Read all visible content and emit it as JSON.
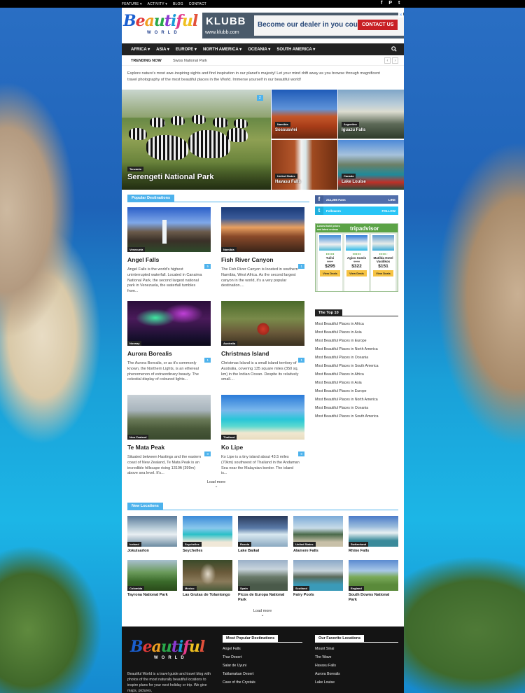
{
  "topbar": {
    "menu": [
      "FEATURE ▾",
      "ACTIVITY ▾",
      "BLOG",
      "CONTACT"
    ],
    "social": [
      "f",
      "P",
      "t"
    ]
  },
  "logo": {
    "word": "Beautiful",
    "sub": "WORLD"
  },
  "ad": {
    "brand": "KLUBB",
    "url": "www.klubb.com",
    "message": "Become our dealer in you country!",
    "cta": "CONTACT US",
    "close": "✕"
  },
  "nav": {
    "items": [
      "AFRICA ▾",
      "ASIA ▾",
      "EUROPE ▾",
      "NORTH AMERICA ▾",
      "OCEANIA ▾",
      "SOUTH AMERICA ▾"
    ]
  },
  "trending": {
    "label": "TRENDING NOW",
    "item": "Swiss National Park",
    "prev": "‹",
    "next": "›"
  },
  "intro": "Explore nature's most awe-inspiring sights and find inspiration in our planet's majesty! Let your mind drift away as you browse through magnificent travel photography of the most beautiful places in the World. Immerse yourself in our beautiful world!",
  "hero": {
    "big": {
      "category": "Tanzania",
      "title": "Serengeti National Park",
      "count": "2"
    },
    "small": [
      {
        "category": "Namibia",
        "title": "Sossusvlei"
      },
      {
        "category": "Argentina",
        "title": "Iguazu Falls"
      },
      {
        "category": "United States",
        "title": "Havasu Falls"
      },
      {
        "category": "Canada",
        "title": "Lake Louise"
      }
    ]
  },
  "popular": {
    "heading": "Popular Destinations",
    "load_more": "Load more",
    "cards": [
      {
        "category": "Venezuela",
        "title": "Angel Falls",
        "count": "5",
        "excerpt": "Angel Falls is the world's highest uninterrupted waterfall. Located in Canaima National Park, the second largest national park in Venezuela, the waterfall tumbles from..."
      },
      {
        "category": "Namibia",
        "title": "Fish River Canyon",
        "count": "1",
        "excerpt": "The Fish River Canyon is located in southern Namibia, West Africa. As the second largest canyon in the world, it's a very popular destination...."
      },
      {
        "category": "Norway",
        "title": "Aurora Borealis",
        "count": "1",
        "excerpt": "The Aurora Borealis, or as it's commonly known, the Northern Lights, is an ethereal phenomenon of extraordinary beauty. The celestial display of coloured lights..."
      },
      {
        "category": "Australia",
        "title": "Christmas Island",
        "count": "1",
        "excerpt": "Christmas Island is a small island territory of Australia, covering 135 square miles (350 sq. km) in the Indian Ocean. Despite its relatively small...."
      },
      {
        "category": "New Zealand",
        "title": "Te Mata Peak",
        "count": "0",
        "excerpt": "Situated between Hastings and the eastern coast of New Zealand, Te Mata Peak is an incredible hillscape rising 1310ft (399m) above sea level. It's..."
      },
      {
        "category": "Thailand",
        "title": "Ko Lipe",
        "count": "0",
        "excerpt": "Ko Lipe is a tiny island about 43.5 miles (70km) southwest of Thailand in the Andaman Sea near the Malaysian border. The island is..."
      }
    ]
  },
  "sidebar": {
    "facebook": {
      "icon": "f",
      "count": "211,285",
      "label": "Fans",
      "action": "LIKE"
    },
    "twitter": {
      "icon": "t",
      "count": "",
      "label": "Followers",
      "action": "FOLLOW"
    },
    "trip": {
      "promo": "Lowest hotel prices and latest reviews",
      "brand": "tripadvisor",
      "hotels": [
        {
          "name": "Tulivi",
          "old": "$327",
          "price": "$295",
          "deal": "View Deals"
        },
        {
          "name": "Agios Sostis",
          "old": "$358",
          "price": "$322",
          "deal": "View Deals"
        },
        {
          "name": "Matilda Hotel Vasilikos",
          "old": "",
          "price": "$151",
          "deal": "View Deals"
        }
      ]
    },
    "top10_heading": "The Top 10",
    "top10": [
      "Most Beautiful Places in Africa",
      "Most Beautiful Places in Asia",
      "Most Beautiful Places in Europe",
      "Most Beautiful Places in North America",
      "Most Beautiful Places in Oceania",
      "Most Beautiful Places in South America",
      "Most Beautiful Places in Africa",
      "Most Beautiful Places in Asia",
      "Most Beautiful Places in Europe",
      "Most Beautiful Places in North America",
      "Most Beautiful Places in Oceania",
      "Most Beautiful Places in South America"
    ]
  },
  "new_locations": {
    "heading": "New Locations",
    "load_more": "Load more",
    "items": [
      {
        "category": "Iceland",
        "title": "Jokulsarlon"
      },
      {
        "category": "Seychelles",
        "title": "Seychelles"
      },
      {
        "category": "Russia",
        "title": "Lake Baikal"
      },
      {
        "category": "United States",
        "title": "Alamere Falls"
      },
      {
        "category": "Switzerland",
        "title": "Rhine Falls"
      },
      {
        "category": "Colombia",
        "title": "Tayrona National Park"
      },
      {
        "category": "Mexico",
        "title": "Las Grutas de Tolantongo"
      },
      {
        "category": "Spain",
        "title": "Picos de Europa National Park"
      },
      {
        "category": "Scotland",
        "title": "Fairy Pools"
      },
      {
        "category": "England",
        "title": "South Downs National Park"
      }
    ]
  },
  "footer": {
    "desc": "Beautiful World is a travel guide and travel blog with photos of the most naturally beautiful locations to inspire plans for your next holiday or trip. We give maps, pictures,",
    "col1_heading": "Most Popular Destinations",
    "col1": [
      "Angel Falls",
      "Thar Desert",
      "Salar de Uyuni",
      "Taklamakan Desert",
      "Cave of the Crystals"
    ],
    "col2_heading": "Our Favorite Locations",
    "col2": [
      "Mount Sinai",
      "The Wave",
      "Havasu Falls",
      "Aurora Borealis",
      "Lake Louise"
    ]
  }
}
